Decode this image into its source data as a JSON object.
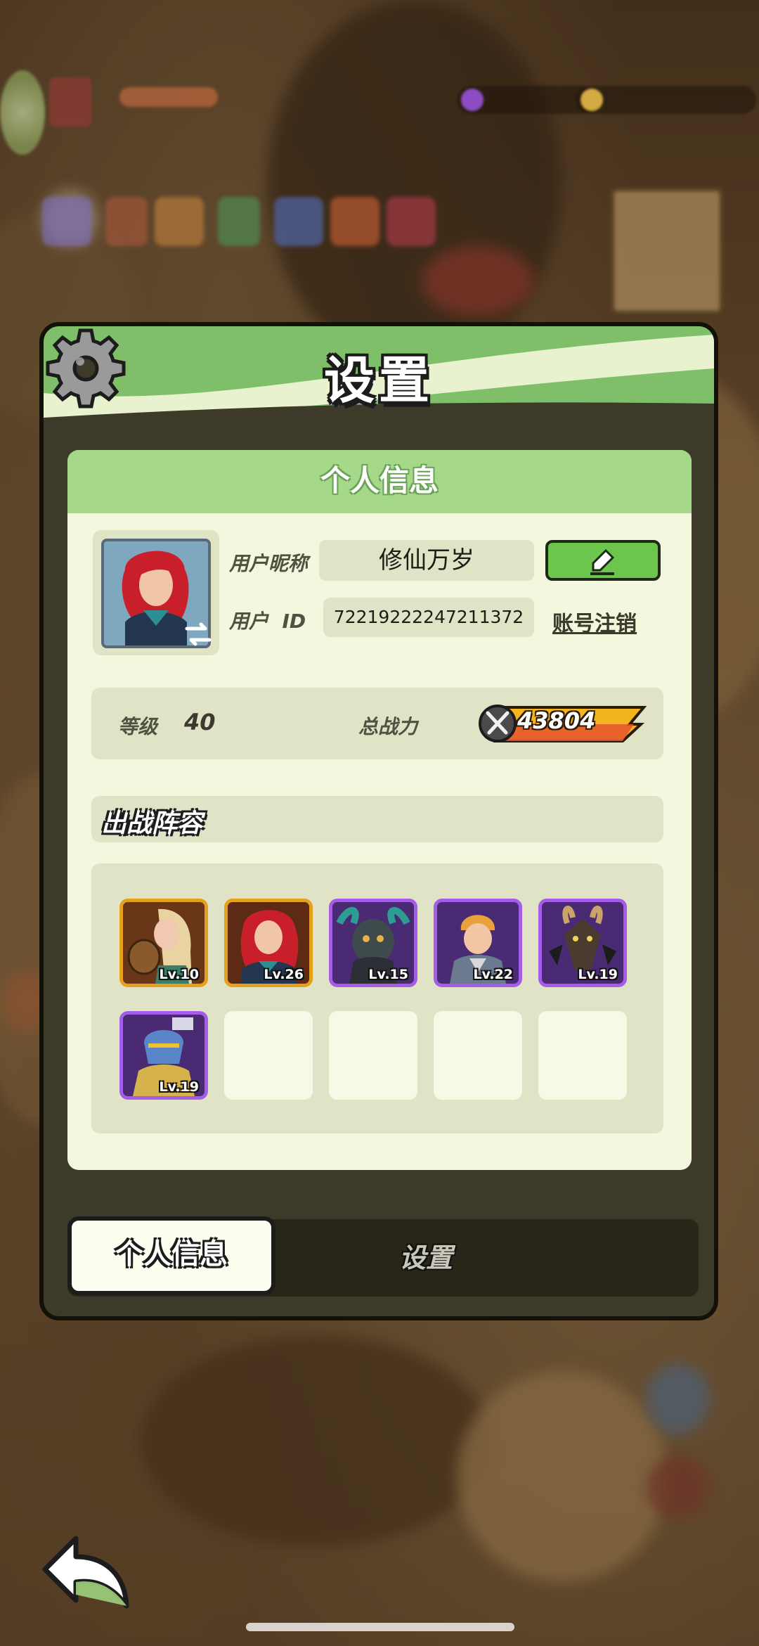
{
  "dialog": {
    "title": "设置",
    "icon": "gear-icon"
  },
  "profile": {
    "section_title": "个人信息",
    "nickname_label": "用户昵称",
    "nickname_value": "修仙万岁",
    "id_label": "用户  ID",
    "id_value": "72219222247211372",
    "logout_label": "账号注销",
    "edit_icon": "pencil-icon",
    "swap_icon": "swap-icon"
  },
  "stats": {
    "level_label": "等级",
    "level_value": "40",
    "power_label": "总战力",
    "power_value": "43804",
    "power_icon": "crossed-swords-icon"
  },
  "lineup": {
    "title": "出战阵容",
    "heroes": [
      {
        "level": "Lv.10",
        "rarity": "orange"
      },
      {
        "level": "Lv.26",
        "rarity": "orange"
      },
      {
        "level": "Lv.15",
        "rarity": "purple"
      },
      {
        "level": "Lv.22",
        "rarity": "purple"
      },
      {
        "level": "Lv.19",
        "rarity": "purple"
      },
      {
        "level": "Lv.19",
        "rarity": "purple"
      }
    ],
    "empty_slots": 4
  },
  "tabs": [
    {
      "label": "个人信息",
      "active": true
    },
    {
      "label": "设置",
      "active": false
    }
  ],
  "nav": {
    "back_icon": "back-arrow-icon"
  },
  "colors": {
    "header_green": "#7fbf6a",
    "panel_bg": "#f2f7dd",
    "edit_green": "#6cc54c",
    "orange_frame": "#e5a11d",
    "purple_frame": "#a55de8"
  }
}
